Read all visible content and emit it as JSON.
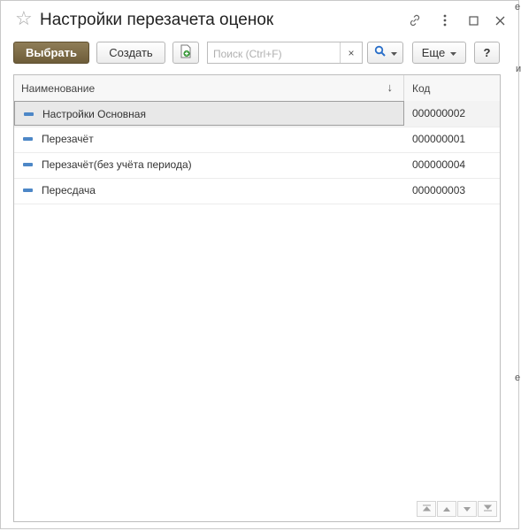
{
  "window": {
    "title": "Настройки перезачета оценок"
  },
  "toolbar": {
    "select_label": "Выбрать",
    "create_label": "Создать",
    "search_placeholder": "Поиск (Ctrl+F)",
    "search_clear": "×",
    "more_label": "Еще",
    "help_label": "?"
  },
  "grid": {
    "columns": {
      "name": "Наименование",
      "code": "Код"
    },
    "rows": [
      {
        "name": "Настройки Основная",
        "code": "000000002",
        "selected": true
      },
      {
        "name": "Перезачёт",
        "code": "000000001",
        "selected": false
      },
      {
        "name": "Перезачёт(без учёта периода)",
        "code": "000000004",
        "selected": false
      },
      {
        "name": "Пересдача",
        "code": "000000003",
        "selected": false
      }
    ]
  },
  "colors": {
    "primary_button": "#7a6844",
    "item_icon": "#4d87c7",
    "search_icon": "#2a6fc9",
    "add_icon": "#3a9a3a"
  },
  "icons": {
    "favorite": "star-icon",
    "link": "link-icon",
    "menu": "more-vertical-icon",
    "maximize": "maximize-icon",
    "close": "close-icon",
    "search": "search-icon",
    "add_from_template": "add-document-icon",
    "sort": "sort-arrow-icon",
    "item": "catalog-item-icon"
  },
  "edge": {
    "top_right_letter": "е",
    "mid_right_letter": "и",
    "lower_right_letter": "е"
  }
}
